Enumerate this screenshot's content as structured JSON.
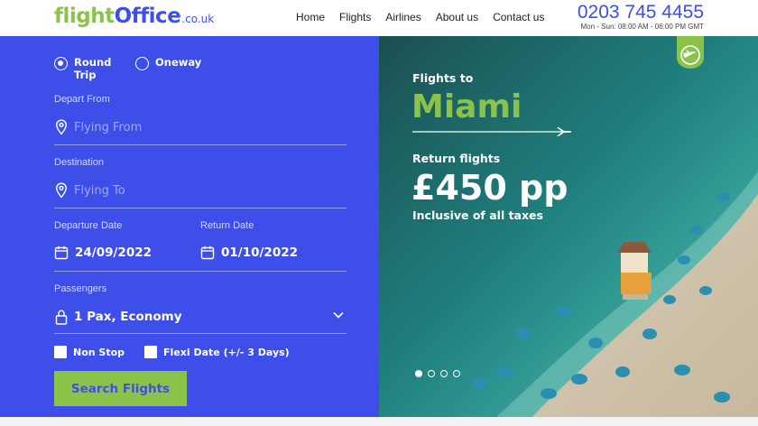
{
  "header": {
    "logo": {
      "part1": "flight",
      "part2": "Office",
      "part3": ".co.uk"
    },
    "nav": [
      "Home",
      "Flights",
      "Airlines",
      "About us",
      "Contact us"
    ],
    "phone": "0203 745 4455",
    "hours": "Mon - Sun: 08:00 AM - 06:00 PM GMT"
  },
  "form": {
    "trip_types": [
      {
        "label": "Round Trip",
        "selected": true
      },
      {
        "label": "Oneway",
        "selected": false
      }
    ],
    "depart": {
      "label": "Depart From",
      "placeholder": "Flying From"
    },
    "destination": {
      "label": "Destination",
      "placeholder": "Flying To"
    },
    "departure_date": {
      "label": "Departure Date",
      "value": "24/09/2022"
    },
    "return_date": {
      "label": "Return Date",
      "value": "01/10/2022"
    },
    "passengers": {
      "label": "Passengers",
      "value": "1 Pax, Economy"
    },
    "options": [
      {
        "label": "Non Stop",
        "checked": false
      },
      {
        "label": "Flexi Date (+/- 3 Days)",
        "checked": false
      }
    ],
    "search_label": "Search Flights"
  },
  "hero": {
    "flights_to": "Flights to",
    "city": "Miami",
    "return_label": "Return flights",
    "price": "£450 pp",
    "inclusive": "Inclusive of all taxes",
    "slides": 4,
    "active_slide": 1
  },
  "colors": {
    "brand_blue": "#3d4fe8",
    "brand_green": "#8bc34a"
  }
}
